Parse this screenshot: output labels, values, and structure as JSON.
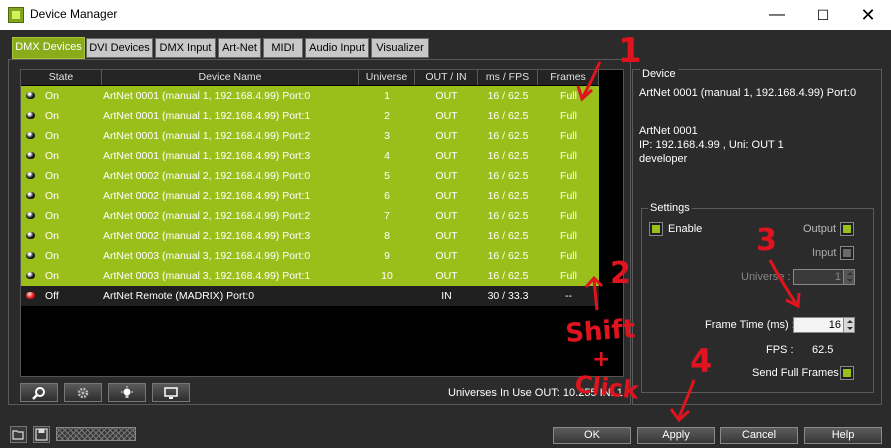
{
  "window": {
    "title": "Device Manager",
    "minimize": "—",
    "maximize": "☐",
    "close": "✕"
  },
  "tabs": [
    "DMX Devices",
    "DVI Devices",
    "DMX Input",
    "Art-Net",
    "MIDI",
    "Audio Input",
    "Visualizer"
  ],
  "table": {
    "columns": [
      "State",
      "Device Name",
      "Universe",
      "OUT / IN",
      "ms / FPS",
      "Frames"
    ],
    "rows": [
      {
        "state": "On",
        "name": "ArtNet 0001 (manual 1, 192.168.4.99) Port:0",
        "universe": "1",
        "outin": "OUT",
        "ms": "16 / 62.5",
        "frames": "Full"
      },
      {
        "state": "On",
        "name": "ArtNet 0001 (manual 1, 192.168.4.99) Port:1",
        "universe": "2",
        "outin": "OUT",
        "ms": "16 / 62.5",
        "frames": "Full"
      },
      {
        "state": "On",
        "name": "ArtNet 0001 (manual 1, 192.168.4.99) Port:2",
        "universe": "3",
        "outin": "OUT",
        "ms": "16 / 62.5",
        "frames": "Full"
      },
      {
        "state": "On",
        "name": "ArtNet 0001 (manual 1, 192.168.4.99) Port:3",
        "universe": "4",
        "outin": "OUT",
        "ms": "16 / 62.5",
        "frames": "Full"
      },
      {
        "state": "On",
        "name": "ArtNet 0002 (manual 2, 192.168.4.99) Port:0",
        "universe": "5",
        "outin": "OUT",
        "ms": "16 / 62.5",
        "frames": "Full"
      },
      {
        "state": "On",
        "name": "ArtNet 0002 (manual 2, 192.168.4.99) Port:1",
        "universe": "6",
        "outin": "OUT",
        "ms": "16 / 62.5",
        "frames": "Full"
      },
      {
        "state": "On",
        "name": "ArtNet 0002 (manual 2, 192.168.4.99) Port:2",
        "universe": "7",
        "outin": "OUT",
        "ms": "16 / 62.5",
        "frames": "Full"
      },
      {
        "state": "On",
        "name": "ArtNet 0002 (manual 2, 192.168.4.99) Port:3",
        "universe": "8",
        "outin": "OUT",
        "ms": "16 / 62.5",
        "frames": "Full"
      },
      {
        "state": "On",
        "name": "ArtNet 0003 (manual 3, 192.168.4.99) Port:0",
        "universe": "9",
        "outin": "OUT",
        "ms": "16 / 62.5",
        "frames": "Full"
      },
      {
        "state": "On",
        "name": "ArtNet 0003 (manual 3, 192.168.4.99) Port:1",
        "universe": "10",
        "outin": "OUT",
        "ms": "16 / 62.5",
        "frames": "Full"
      },
      {
        "state": "Off",
        "name": "ArtNet Remote (MADRIX) Port:0",
        "universe": "",
        "outin": "IN",
        "ms": "30 / 33.3",
        "frames": "--"
      }
    ]
  },
  "toolbar": {
    "universes_in_use": "Universes In Use OUT: 10.255 IN: 1"
  },
  "device_panel": {
    "legend": "Device",
    "title": "ArtNet 0001 (manual 1, 192.168.4.99) Port:0",
    "info_name": "ArtNet 0001",
    "info_ip": "IP: 192.168.4.99 , Uni: OUT 1",
    "info_user": "developer"
  },
  "settings": {
    "legend": "Settings",
    "enable_label": "Enable",
    "output_label": "Output",
    "input_label": "Input",
    "universe_label": "Universe :",
    "universe_value": "1",
    "frame_time_label": "Frame Time (ms) :",
    "frame_time_value": "16",
    "fps_label": "FPS :",
    "fps_value": "62.5",
    "send_full_label": "Send Full Frames"
  },
  "buttons": {
    "ok": "OK",
    "apply": "Apply",
    "cancel": "Cancel",
    "help": "Help"
  },
  "annotations": {
    "n1": "1",
    "n2": "2",
    "n3": "3",
    "n4": "4",
    "shift": "Shift",
    "plus": "+",
    "click": "Click"
  },
  "colors": {
    "active_row": "#9bbf1a",
    "background": "#2b2b2b",
    "annotation": "#e0141e"
  }
}
